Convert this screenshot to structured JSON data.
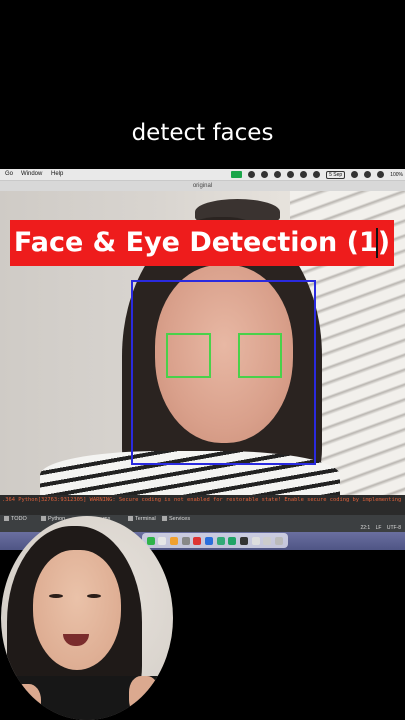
{
  "caption": "detect faces",
  "menubar": {
    "items": [
      "Go",
      "Window",
      "Help"
    ],
    "tray_date": "5 Sep",
    "battery": "100%"
  },
  "window_title": "original",
  "video": {
    "banner_title": "Face & Eye Detection (1)"
  },
  "console": {
    "log_line": ".364 Python[32763:9312305] WARNING: Secure coding is not enabled for restorable state! Enable secure coding by implementing"
  },
  "tool_tabs": [
    "TODO",
    "Python",
    "ms",
    "Terminal",
    "Services"
  ],
  "status": {
    "position": "22:1",
    "line_sep": "LF",
    "encoding": "UTF-8"
  },
  "colors": {
    "banner": "#ee1c1c",
    "face_box": "#2a2adf",
    "eye_box": "#49d14a"
  }
}
